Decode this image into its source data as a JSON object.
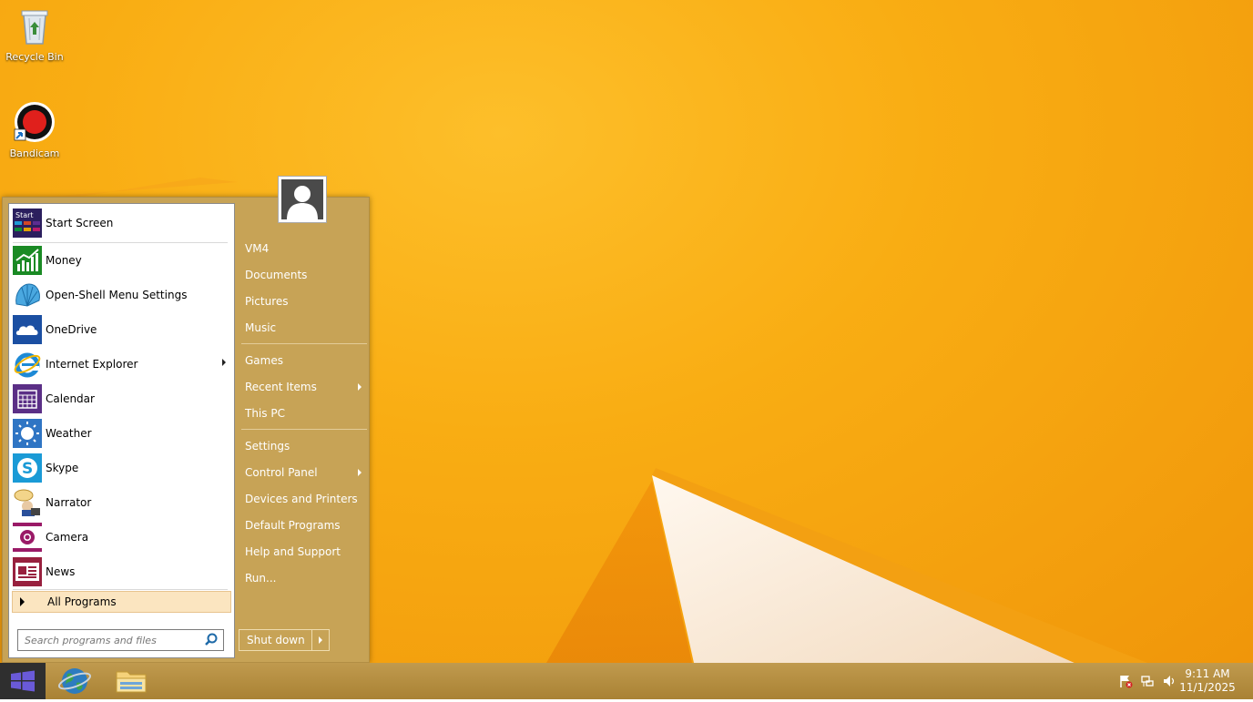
{
  "desktop": {
    "icons": [
      {
        "label": "Recycle Bin",
        "icon": "recycle-bin-icon"
      },
      {
        "label": "Bandicam",
        "icon": "bandicam-icon"
      }
    ]
  },
  "start_menu": {
    "pinned": [
      {
        "label": "Start Screen",
        "icon": "start-screen-icon",
        "icon_text": "Start"
      }
    ],
    "programs": [
      {
        "label": "Money",
        "icon": "money-icon",
        "color": "#1a8a24"
      },
      {
        "label": "Open-Shell Menu Settings",
        "icon": "shell-icon"
      },
      {
        "label": "OneDrive",
        "icon": "onedrive-icon",
        "color": "#1b4fa2"
      },
      {
        "label": "Internet Explorer",
        "icon": "internet-explorer-icon",
        "has_submenu": true
      },
      {
        "label": "Calendar",
        "icon": "calendar-icon",
        "color": "#5b2f86"
      },
      {
        "label": "Weather",
        "icon": "weather-icon",
        "color": "#2f75c4"
      },
      {
        "label": "Skype",
        "icon": "skype-icon",
        "color": "#1a9ad6"
      },
      {
        "label": "Narrator",
        "icon": "narrator-icon"
      },
      {
        "label": "Camera",
        "icon": "camera-icon",
        "color": "#9a1a67"
      },
      {
        "label": "News",
        "icon": "news-icon",
        "color": "#98203e"
      }
    ],
    "all_programs": "All Programs",
    "search": {
      "placeholder": "Search programs and files"
    },
    "right": {
      "group1": [
        {
          "label": "VM4"
        },
        {
          "label": "Documents"
        },
        {
          "label": "Pictures"
        },
        {
          "label": "Music"
        }
      ],
      "group2": [
        {
          "label": "Games"
        },
        {
          "label": "Recent Items",
          "has_submenu": true
        },
        {
          "label": "This PC"
        }
      ],
      "group3": [
        {
          "label": "Settings"
        },
        {
          "label": "Control Panel",
          "has_submenu": true
        },
        {
          "label": "Devices and Printers"
        },
        {
          "label": "Default Programs"
        },
        {
          "label": "Help and Support"
        },
        {
          "label": "Run..."
        }
      ]
    },
    "shutdown": "Shut down"
  },
  "taskbar": {
    "pinned": [
      {
        "icon": "internet-globe-icon"
      },
      {
        "icon": "file-explorer-icon"
      }
    ],
    "tray": [
      "action-center-flag-icon",
      "network-icon",
      "volume-icon"
    ],
    "clock": {
      "time": "9:11 AM",
      "date": "11/1/2025"
    }
  },
  "colors": {
    "accent": "#c7a356",
    "taskbar": "#b78d3f",
    "desktop": "#f9ad13"
  }
}
